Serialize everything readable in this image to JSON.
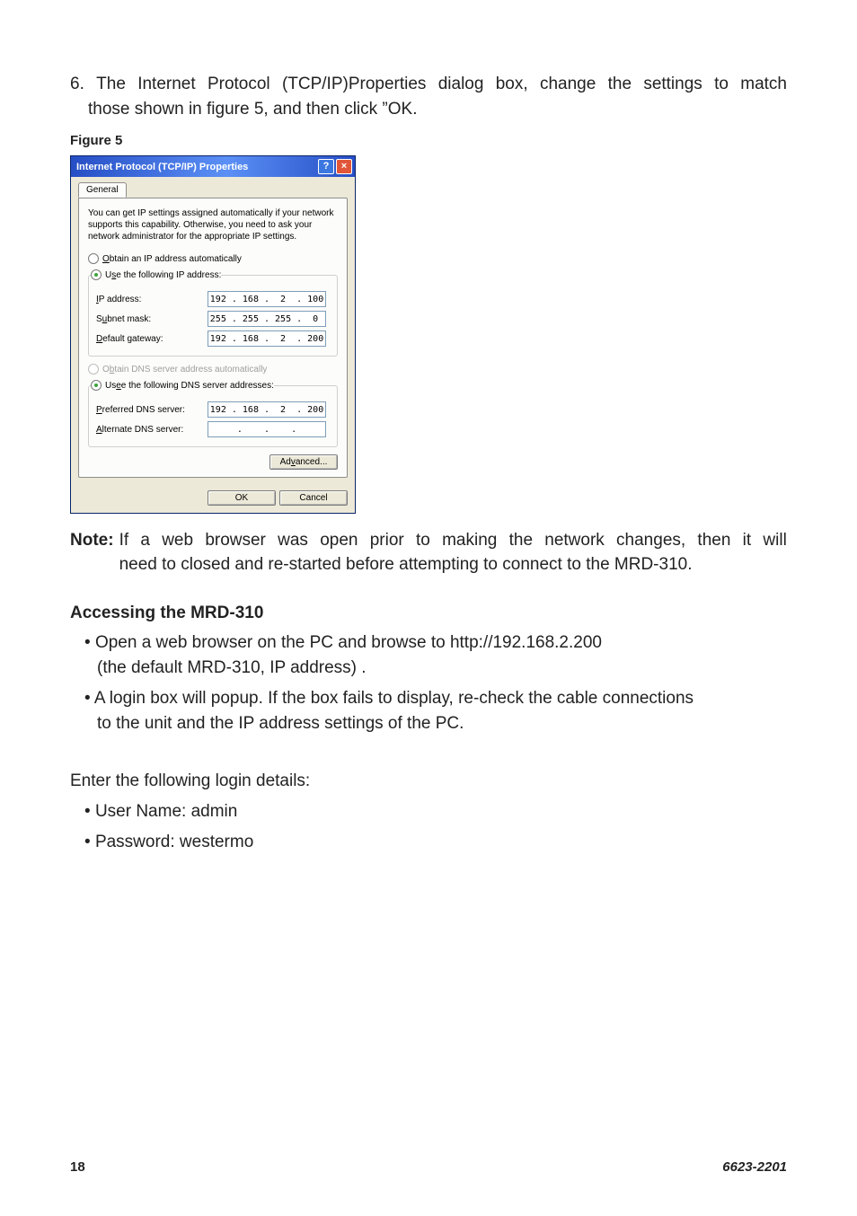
{
  "step6_line1_words": [
    "6.",
    "The",
    "Internet",
    "Protocol",
    "(TCP/IP)Properties",
    "dialog",
    "box,",
    "change",
    "the",
    "settings",
    "to",
    "match"
  ],
  "step6_line2": "those shown in figure 5, and then click ”OK.",
  "figure_label": "Figure 5",
  "dialog": {
    "title": "Internet Protocol (TCP/IP) Properties",
    "help_icon": "?",
    "close_icon": "×",
    "tab_general": "General",
    "info": "You can get IP settings assigned automatically if your network supports this capability. Otherwise, you need to ask your network administrator for the appropriate IP settings.",
    "r_obtain_ip": "btain an IP address automatically",
    "r_use_ip": "e the following IP address:",
    "lbl_ip_pre": "",
    "lbl_ip_u": "I",
    "lbl_ip_post": "P address:",
    "val_ip": "192 . 168 .  2  . 100",
    "lbl_sub_pre": "S",
    "lbl_sub_u": "u",
    "lbl_sub_post": "bnet mask:",
    "val_sub": "255 . 255 . 255 .  0 ",
    "lbl_gw_u": "D",
    "lbl_gw_post": "efault gateway:",
    "val_gw": "192 . 168 .  2  . 200",
    "r_obtain_dns": "tain DNS server address automatically",
    "r_use_dns": "e the following DNS server addresses:",
    "lbl_pdns_u": "P",
    "lbl_pdns_post": "referred DNS server:",
    "val_pdns": "192 . 168 .  2  . 200",
    "lbl_adns_u": "A",
    "lbl_adns_post": "lternate DNS server:",
    "val_adns": "   .    .    .   ",
    "btn_adv_pre": "Ad",
    "btn_adv_u": "v",
    "btn_adv_post": "anced...",
    "btn_ok": "OK",
    "btn_cancel": "Cancel"
  },
  "note_lead": "Note:",
  "note_l1_words": [
    "If",
    "a",
    "web",
    "browser",
    "was",
    "open",
    "prior",
    "to",
    "making",
    "the",
    "network",
    "changes,",
    "then",
    "it",
    "will"
  ],
  "note_l2": "need to closed and re-started before attempting to connect to the MRD-310.",
  "h_access": "Accessing the MRD-310",
  "b1a": "Open a web browser on the PC and browse to http://192.168.2.200",
  "b1b": "(the default MRD-310,  IP address) .",
  "b2a": "A login box will popup. If the box fails to display, re-check the cable connections",
  "b2b": "to the unit and the IP address settings of the PC.",
  "enter": "Enter the following login details:",
  "b3": "User Name: admin",
  "b4": "Password: westermo",
  "page_no": "18",
  "doc_no": "6623-2201"
}
